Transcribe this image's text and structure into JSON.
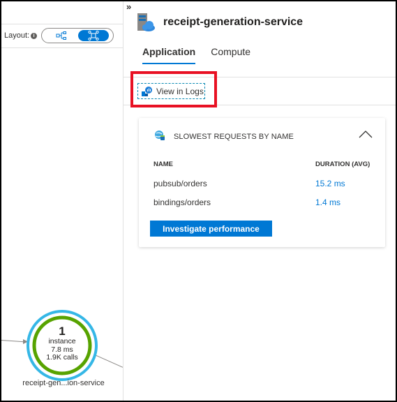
{
  "canvas": {
    "layout_label": "Layout:",
    "layout_options": [
      {
        "name": "hierarchical",
        "icon": "hierarchy-icon",
        "selected": false
      },
      {
        "name": "network",
        "icon": "network-icon",
        "selected": true
      }
    ],
    "node": {
      "count": "1",
      "unit": "instance",
      "duration": "7.8 ms",
      "calls": "1.9K calls",
      "label": "receipt-gen...ion-service",
      "ring_color": "#35b7e6",
      "health_color": "#57a300"
    }
  },
  "panel": {
    "collapse_glyph": "»",
    "title": "receipt-generation-service",
    "tabs": [
      {
        "label": "Application",
        "active": true
      },
      {
        "label": "Compute",
        "active": false
      }
    ],
    "toolbar": {
      "view_in_logs_label": "View in Logs"
    },
    "card": {
      "title": "SLOWEST REQUESTS BY NAME",
      "columns": [
        "NAME",
        "DURATION (AVG)"
      ],
      "rows": [
        {
          "name": "pubsub/orders",
          "duration": "15.2 ms"
        },
        {
          "name": "bindings/orders",
          "duration": "1.4 ms"
        }
      ],
      "action_label": "Investigate performance"
    }
  },
  "colors": {
    "accent": "#0078d4",
    "highlight": "#e81123"
  }
}
